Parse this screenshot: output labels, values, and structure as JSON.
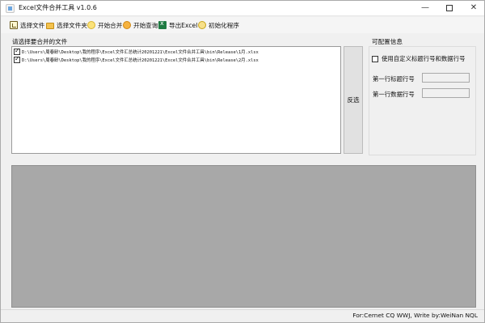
{
  "window": {
    "title": "Excel文件合并工具 v1.0.6",
    "minimize_glyph": "—",
    "close_glyph": "✕"
  },
  "toolbar": {
    "items": [
      {
        "label": "选择文件",
        "icon": "file-icon"
      },
      {
        "label": "选择文件夹",
        "icon": "folder-icon"
      },
      {
        "label": "开始合并",
        "icon": "merge-icon"
      },
      {
        "label": "开始查询",
        "icon": "query-icon"
      },
      {
        "label": "导出Excel",
        "icon": "excel-icon"
      },
      {
        "label": "初始化程序",
        "icon": "init-icon"
      }
    ]
  },
  "files": {
    "group_label": "请选择要合并的文件",
    "items": [
      {
        "path": "D:\\Users\\周春龄\\Desktop\\我的程序\\Excel文件汇总统计20201221\\Excel文件合并工具\\bin\\Release\\1月.xlsx",
        "checked": true
      },
      {
        "path": "D:\\Users\\周春龄\\Desktop\\我的程序\\Excel文件汇总统计20201221\\Excel文件合并工具\\bin\\Release\\2月.xlsx",
        "checked": true
      }
    ],
    "invert_label": "反选"
  },
  "config": {
    "group_label": "可配置信息",
    "custom_rows_label": "使用自定义标题行号和数据行号",
    "custom_rows_checked": false,
    "header_row_label": "第一行标题行号",
    "header_row_value": "",
    "data_row_label": "第一行数据行号",
    "data_row_value": ""
  },
  "status": {
    "text": "For:Cernet CQ WWJ, Write by:WeiNan NQL"
  },
  "colors": {
    "window_bg": "#f0f0f0",
    "log_bg": "#a8a8a8",
    "list_bg": "#ffffff"
  }
}
